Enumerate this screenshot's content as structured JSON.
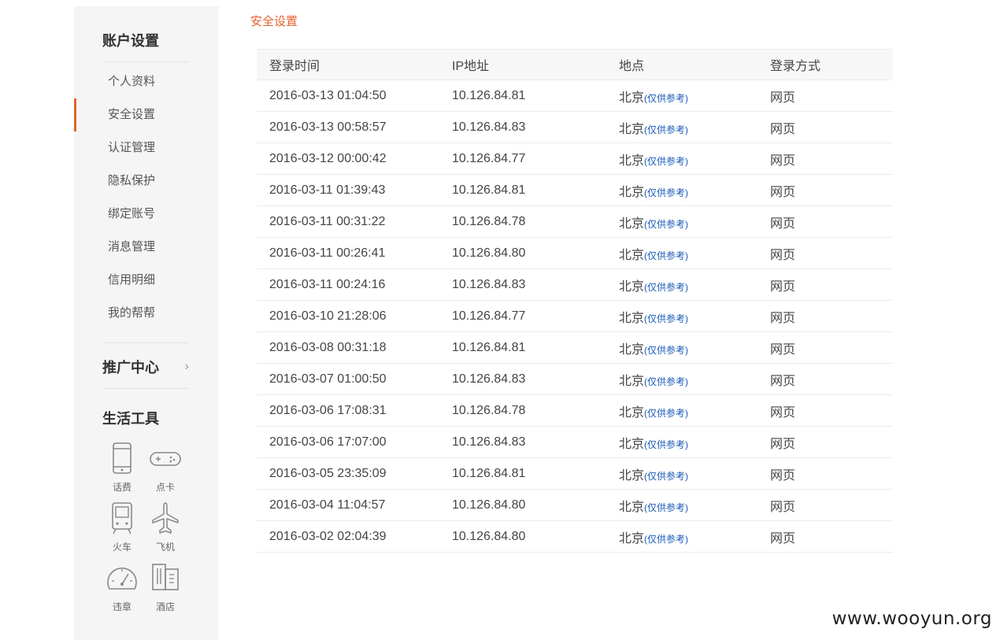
{
  "sidebar": {
    "account_title": "账户设置",
    "items": [
      {
        "label": "个人资料",
        "active": false
      },
      {
        "label": "安全设置",
        "active": true
      },
      {
        "label": "认证管理",
        "active": false
      },
      {
        "label": "隐私保护",
        "active": false
      },
      {
        "label": "绑定账号",
        "active": false
      },
      {
        "label": "消息管理",
        "active": false
      },
      {
        "label": "信用明细",
        "active": false
      },
      {
        "label": "我的帮帮",
        "active": false
      }
    ],
    "promo_label": "推广中心",
    "tools_title": "生活工具",
    "tools": [
      {
        "label": "话费",
        "icon": "phone-icon"
      },
      {
        "label": "点卡",
        "icon": "gamepad-icon"
      },
      {
        "label": "火车",
        "icon": "train-icon"
      },
      {
        "label": "飞机",
        "icon": "plane-icon"
      },
      {
        "label": "违章",
        "icon": "speedometer-icon"
      },
      {
        "label": "酒店",
        "icon": "hotel-icon"
      }
    ]
  },
  "breadcrumb": "安全设置",
  "table": {
    "headers": [
      "登录时间",
      "IP地址",
      "地点",
      "登录方式"
    ],
    "rows": [
      {
        "time": "2016-03-13 01:04:50",
        "ip": "10.126.84.81",
        "place": "北京",
        "note": "(仅供参考)",
        "method": "网页"
      },
      {
        "time": "2016-03-13 00:58:57",
        "ip": "10.126.84.83",
        "place": "北京",
        "note": "(仅供参考)",
        "method": "网页"
      },
      {
        "time": "2016-03-12 00:00:42",
        "ip": "10.126.84.77",
        "place": "北京",
        "note": "(仅供参考)",
        "method": "网页"
      },
      {
        "time": "2016-03-11 01:39:43",
        "ip": "10.126.84.81",
        "place": "北京",
        "note": "(仅供参考)",
        "method": "网页"
      },
      {
        "time": "2016-03-11 00:31:22",
        "ip": "10.126.84.78",
        "place": "北京",
        "note": "(仅供参考)",
        "method": "网页"
      },
      {
        "time": "2016-03-11 00:26:41",
        "ip": "10.126.84.80",
        "place": "北京",
        "note": "(仅供参考)",
        "method": "网页"
      },
      {
        "time": "2016-03-11 00:24:16",
        "ip": "10.126.84.83",
        "place": "北京",
        "note": "(仅供参考)",
        "method": "网页"
      },
      {
        "time": "2016-03-10 21:28:06",
        "ip": "10.126.84.77",
        "place": "北京",
        "note": "(仅供参考)",
        "method": "网页"
      },
      {
        "time": "2016-03-08 00:31:18",
        "ip": "10.126.84.81",
        "place": "北京",
        "note": "(仅供参考)",
        "method": "网页"
      },
      {
        "time": "2016-03-07 01:00:50",
        "ip": "10.126.84.83",
        "place": "北京",
        "note": "(仅供参考)",
        "method": "网页"
      },
      {
        "time": "2016-03-06 17:08:31",
        "ip": "10.126.84.78",
        "place": "北京",
        "note": "(仅供参考)",
        "method": "网页"
      },
      {
        "time": "2016-03-06 17:07:00",
        "ip": "10.126.84.83",
        "place": "北京",
        "note": "(仅供参考)",
        "method": "网页"
      },
      {
        "time": "2016-03-05 23:35:09",
        "ip": "10.126.84.81",
        "place": "北京",
        "note": "(仅供参考)",
        "method": "网页"
      },
      {
        "time": "2016-03-04 11:04:57",
        "ip": "10.126.84.80",
        "place": "北京",
        "note": "(仅供参考)",
        "method": "网页"
      },
      {
        "time": "2016-03-02 02:04:39",
        "ip": "10.126.84.80",
        "place": "北京",
        "note": "(仅供参考)",
        "method": "网页"
      }
    ]
  },
  "watermark": "www.wooyun.org",
  "colors": {
    "accent": "#e4632e",
    "note": "#1a5ab8",
    "sidebar_bg": "#f5f5f5"
  }
}
